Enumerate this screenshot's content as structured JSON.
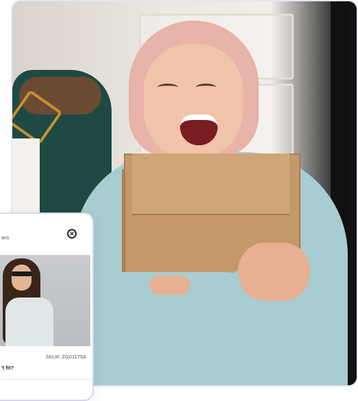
{
  "hero": {
    "alt_hint_icon": "photo"
  },
  "product_card": {
    "brand_fragment": "ans",
    "close_icon": "close-icon",
    "sku_label": "SKU#: ZG01175A",
    "fit_question_fragment": "'t fit?"
  },
  "colors": {
    "card_border": "#d8d6ee",
    "hero_border": "#e6e4f4",
    "sweater": "#a7cdd2",
    "box": "#c4986a"
  }
}
